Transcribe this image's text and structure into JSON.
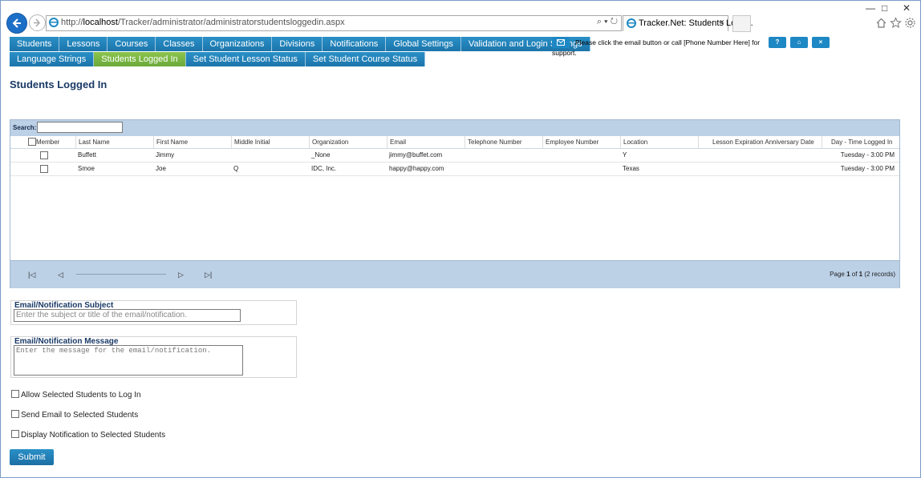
{
  "browser": {
    "url_prefix": "http://",
    "url_host": "localhost",
    "url_path": "/Tracker/administrator/administratorstudentsloggedin.aspx",
    "address_tools": "⌕ ▾ ↻",
    "tab_title": "Tracker.Net: Students Logg...",
    "tab_close": "×"
  },
  "menu": {
    "row1": [
      "Students",
      "Lessons",
      "Courses",
      "Classes",
      "Organizations",
      "Divisions",
      "Notifications",
      "Global Settings",
      "Validation and Login Settings"
    ],
    "row2": [
      "Language Strings",
      "Students Logged In",
      "Set Student Lesson Status",
      "Set Student Course Status"
    ]
  },
  "support": {
    "text_line1": "Please click the email button or call [Phone Number Here] for",
    "text_line2": "support.",
    "help_label": "?",
    "home_label": "⌂",
    "close_label": "×"
  },
  "page": {
    "title": "Students Logged In"
  },
  "grid": {
    "search_label": "Search:",
    "columns": [
      "Member",
      "Last Name",
      "First Name",
      "Middle Initial",
      "Organization",
      "Email",
      "Telephone Number",
      "Employee Number",
      "Location",
      "Lesson Expiration Anniversary Date",
      "Day - Time Logged In"
    ],
    "rows": [
      {
        "last": "Buffett",
        "first": "Jimmy",
        "middle": "",
        "org": "_None",
        "email": "jimmy@buffet.com",
        "phone": "",
        "employee": "",
        "location": "Y",
        "expiration": "",
        "logged_in": "Tuesday - 3:00 PM"
      },
      {
        "last": "Smoe",
        "first": "Joe",
        "middle": "Q",
        "org": "IDC, Inc.",
        "email": "happy@happy.com",
        "phone": "",
        "employee": "",
        "location": "Texas",
        "expiration": "",
        "logged_in": "Tuesday - 3:00 PM"
      }
    ],
    "pager": {
      "first": "|◁",
      "prev": "◁",
      "next": "▷",
      "last": "▷|",
      "info_prefix": "Page ",
      "page": "1",
      "info_of": " of ",
      "total": "1",
      "info_suffix": " (2 records)"
    }
  },
  "form": {
    "subject_label": "Email/Notification Subject",
    "subject_placeholder": "Enter the subject or title of the email/notification.",
    "message_label": "Email/Notification Message",
    "message_placeholder": "Enter the message for the email/notification.",
    "options": [
      "Allow Selected Students to Log In",
      "Send Email to Selected Students",
      "Display Notification to Selected Students"
    ],
    "submit_label": "Submit"
  },
  "colors": {
    "menu": "#1c75ab",
    "menu_active": "#6aa93a",
    "title": "#1a3a66",
    "grid_band": "#bcd0e6"
  }
}
